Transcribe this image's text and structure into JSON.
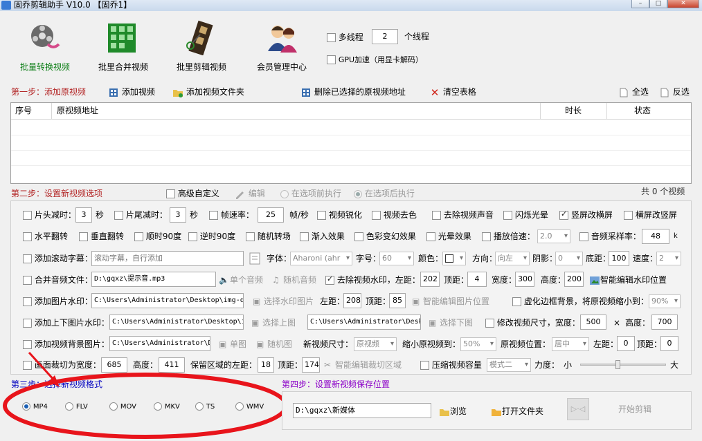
{
  "window": {
    "title": "固乔剪辑助手 V10.0 【固乔1】"
  },
  "toolbar": [
    {
      "label": "批量转换视频"
    },
    {
      "label": "批里合并视频"
    },
    {
      "label": "批里剪辑视频"
    },
    {
      "label": "会员管理中心"
    }
  ],
  "threads": {
    "label": "多线程",
    "value": "2",
    "unit": "个线程",
    "gpu_label": "GPU加速（用显卡解码）"
  },
  "step1": {
    "title": "第一步：添加原视频",
    "add_video": "添加视频",
    "add_folder": "添加视频文件夹",
    "delete_selected": "删除已选择的原视频地址",
    "clear_table": "清空表格",
    "select_all": "全选",
    "invert": "反选"
  },
  "table": {
    "columns": [
      "序号",
      "原视频地址",
      "时长",
      "状态"
    ]
  },
  "step2": {
    "title": "第二步：设置新视频选项",
    "advanced": "高级自定义",
    "edit": "编辑",
    "before": "在选项前执行",
    "after": "在选项后执行",
    "count": "共 0 个视频"
  },
  "opts": {
    "head_cut": "片头减时：",
    "head_val": "3",
    "sec": "秒",
    "tail_cut": "片尾减时：",
    "tail_val": "3",
    "fps": "帧速率：",
    "fps_val": "25",
    "fps_unit": "帧/秒",
    "sharpen": "视频锐化",
    "decolor": "视频去色",
    "remove_audio": "去除视频声音",
    "flash": "闪烁光晕",
    "v2h": "竖屏改横屏",
    "h2v": "横屏改竖屏",
    "hflip": "水平翻转",
    "vflip": "垂直翻转",
    "cw90": "顺时90度",
    "ccw90": "逆时90度",
    "random_trans": "随机转场",
    "fade_in": "渐入效果",
    "color_change": "色彩变幻效果",
    "glow": "光晕效果",
    "speed": "播放倍速：",
    "speed_val": "2.0",
    "sample_rate": "音频采样率：",
    "sample_val": "48",
    "sample_unit": "k",
    "scroll_sub": "添加滚动字幕：",
    "scroll_placeholder": "滚动字幕，自行添加",
    "font": "字体：",
    "font_val": "Aharoni (ahr",
    "size": "字号：",
    "size_val": "60",
    "color": "颜色：",
    "direction": "方向：",
    "direction_val": "向左",
    "shadow": "阴影：",
    "shadow_val": "0",
    "bottom": "底距：",
    "bottom_val": "100",
    "speed2": "速度：",
    "speed2_val": "2",
    "merge_audio": "合并音频文件：",
    "audio_path": "D:\\gqxz\\提示音.mp3",
    "single_audio": "单个音频",
    "random_audio": "随机音频",
    "remove_wm": "去除视频水印，左距：",
    "wm_left": "202",
    "top_dist": "顶距：",
    "wm_top": "4",
    "width": "宽度：",
    "wm_w": "300",
    "height": "高度：",
    "wm_h": "200",
    "smart_wm": "智能编辑水印位置",
    "img_wm": "添加图片水印：",
    "img_wm_path": "C:\\Users\\Administrator\\Desktop\\img-q",
    "choose_wm": "选择水印图片",
    "left_dist": "左距：",
    "img_left": "208",
    "img_top": "85",
    "smart_img": "智能编辑图片位置",
    "blur_bg": "虚化边框背景，将原视频缩小到：",
    "blur_val": "90%",
    "topbottom_wm": "添加上下图片水印：",
    "top_img_path": "C:\\Users\\Administrator\\Desktop\\i",
    "choose_top": "选择上图",
    "bottom_img_path": "C:\\Users\\Administrator\\Desk",
    "choose_bottom": "选择下图",
    "resize": "修改视频尺寸，宽度：",
    "resize_w": "500",
    "times": "×",
    "height2": "高度：",
    "resize_h": "700",
    "bg_img": "添加视频背景图片：",
    "bg_path": "C:\\Users\\Administrator\\D",
    "single_img": "单图",
    "random_img": "随机图",
    "new_size": "新视频尺寸：",
    "new_size_val": "原视频",
    "shrink": "缩小原视频到：",
    "shrink_val": "50%",
    "pos": "原视频位置：",
    "pos_val": "居中",
    "pos_left": "0",
    "pos_top": "0",
    "crop": "画面裁切为宽度：",
    "crop_w": "685",
    "crop_h": "411",
    "keep_left": "保留区域的左距：",
    "keep_left_val": "18",
    "crop_top": "174",
    "smart_crop": "智能编辑裁切区域",
    "compress": "压缩视频容量",
    "compress_mode": "模式二",
    "strength": "力度：",
    "small": "小",
    "big": "大"
  },
  "step3": {
    "title": "第三步：选择新视频格式",
    "formats": [
      "MP4",
      "FLV",
      "MOV",
      "MKV",
      "TS",
      "WMV"
    ],
    "selected": "MP4"
  },
  "step4": {
    "title": "第四步：设置新视频保存位置",
    "path": "D:\\gqxz\\新媒体",
    "browse": "浏览",
    "open_folder": "打开文件夹",
    "start": "开始剪辑"
  },
  "colors": {
    "step_title": "#b22222",
    "step4_title": "#8b00c8",
    "active_toolbar": "#0a7d14",
    "annotation": "#e8141b"
  }
}
